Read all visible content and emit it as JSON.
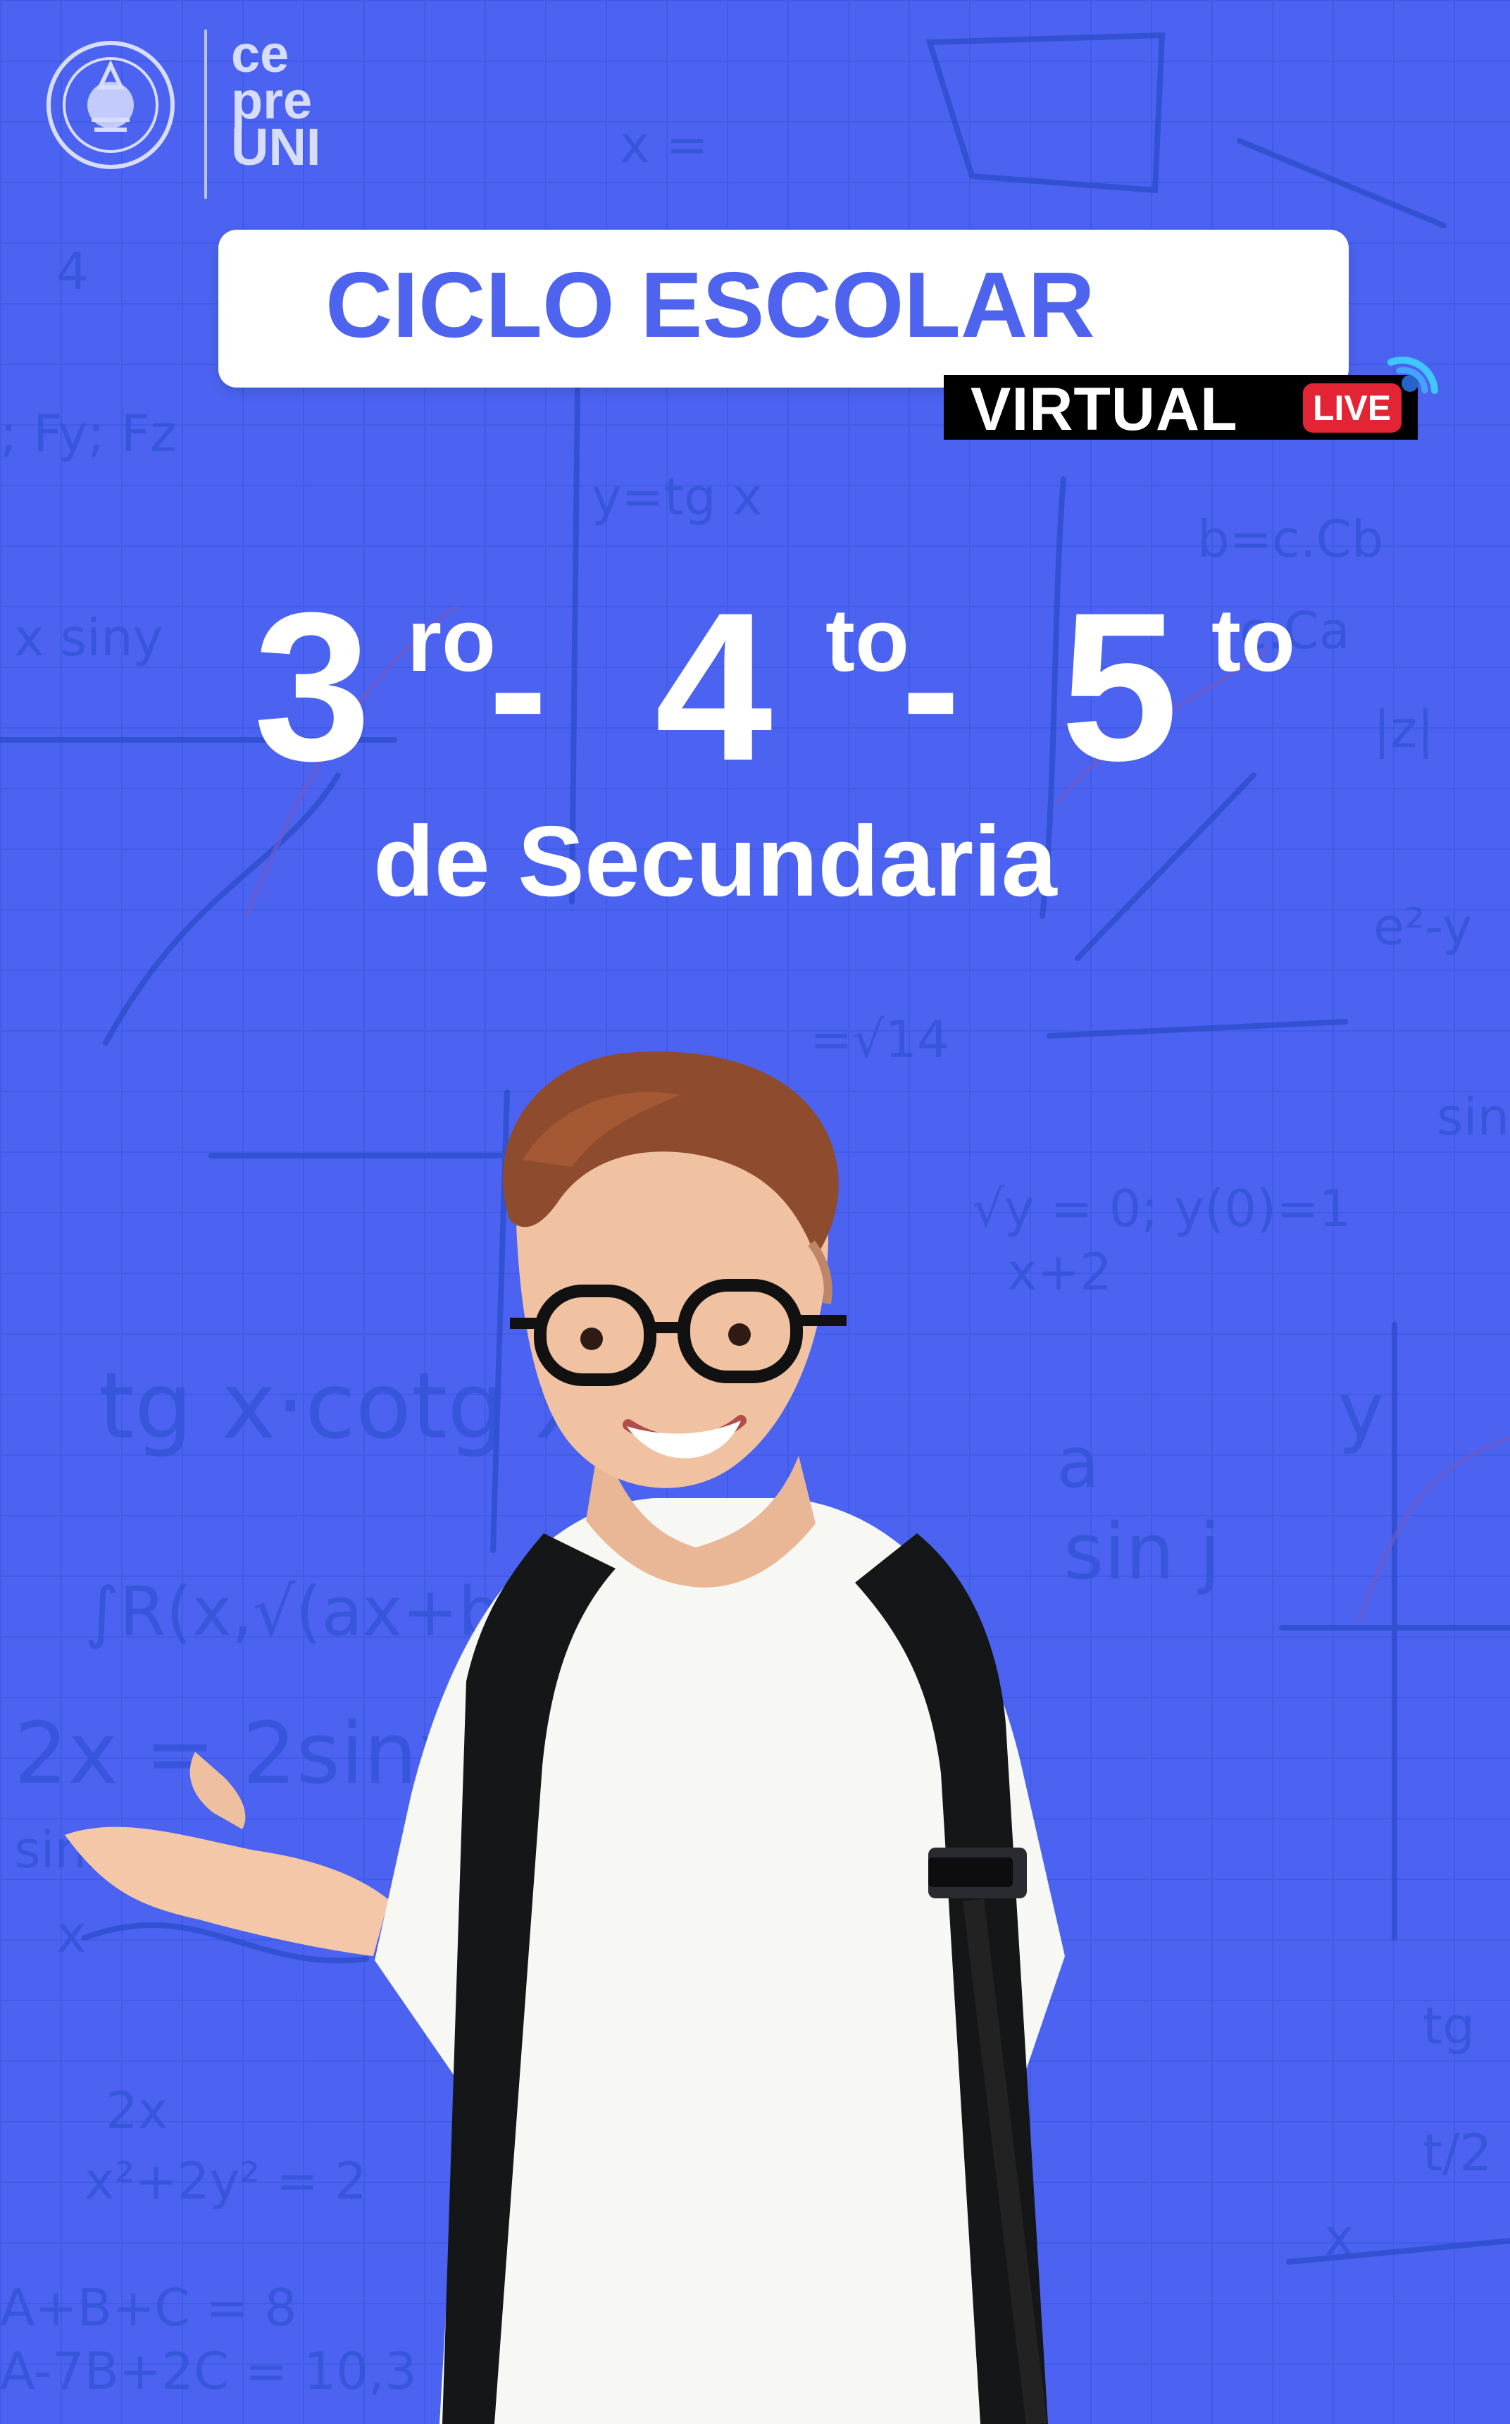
{
  "brand": {
    "lines": [
      "ce",
      "pre",
      "UNI"
    ]
  },
  "header": {
    "title": "CICLO ESCOLAR",
    "mode": "VIRTUAL",
    "live_badge": "LIVE"
  },
  "grades": {
    "g3_number": "3",
    "g3_suffix": "ro",
    "dash_1": "-",
    "g4_number": "4",
    "g4_suffix": "to",
    "dash_2": "-",
    "g5_number": "5",
    "g5_suffix": "to",
    "level": "de Secundaria"
  },
  "colors": {
    "background": "#4b63f0",
    "title_blue": "#4e63ee",
    "live_red": "#e32435",
    "badge_black": "#000000",
    "white": "#ffffff"
  }
}
